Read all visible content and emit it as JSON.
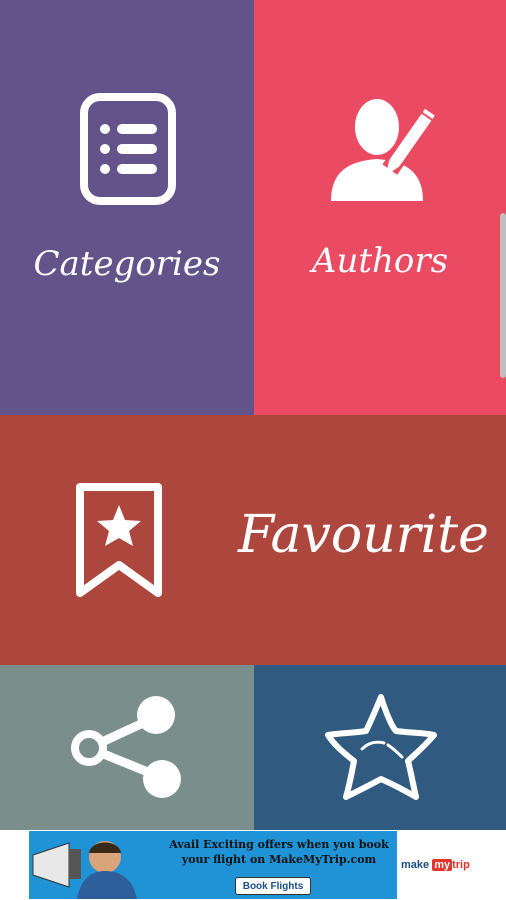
{
  "colors": {
    "categories_bg": "#62538a",
    "authors_bg": "#ea4b63",
    "favourite_bg": "#ad473d",
    "share_bg": "#7a8e8c",
    "rate_bg": "#305a7f"
  },
  "tiles": {
    "categories": {
      "label": "Categories",
      "icon": "list-icon"
    },
    "authors": {
      "label": "Authors",
      "icon": "author-pen-icon"
    },
    "favourite": {
      "label": "Favourite",
      "icon": "bookmark-star-icon"
    },
    "share": {
      "icon": "share-icon"
    },
    "rate": {
      "icon": "star-icon"
    }
  },
  "ad": {
    "headline": "Avail Exciting offers when you book your flight on MakeMyTrip.com",
    "button": "Book Flights",
    "brand_make": "make",
    "brand_my": "my",
    "brand_trip": "trip"
  }
}
